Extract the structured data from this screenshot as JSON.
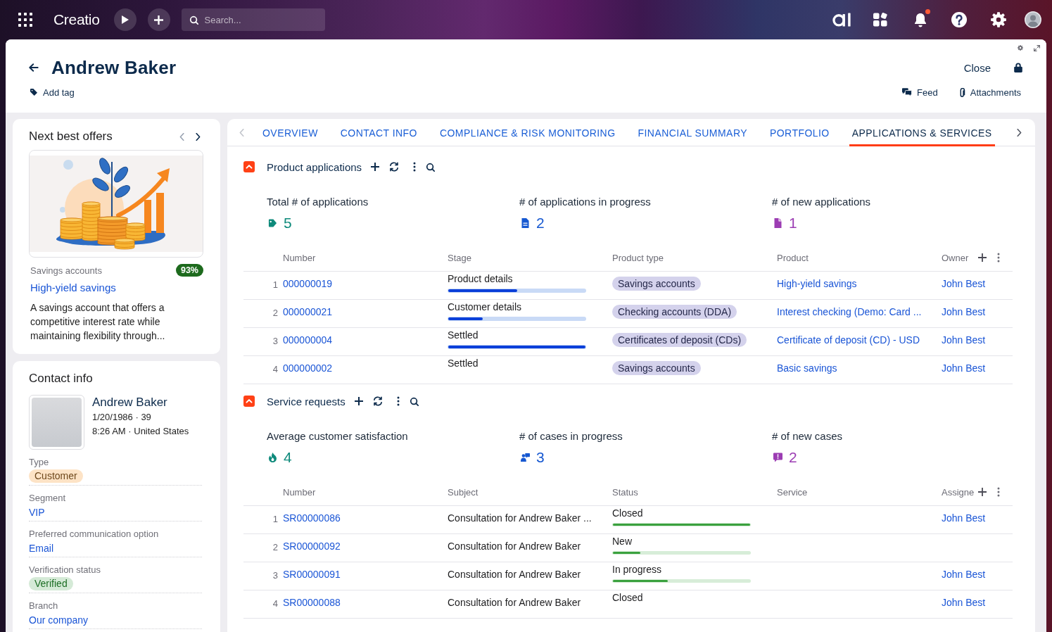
{
  "topbar": {
    "logo": "Creatio",
    "search": {
      "placeholder": "Search..."
    },
    "notifications": {
      "unread": true
    }
  },
  "record": {
    "title": "Andrew Baker",
    "add_tag": "Add tag",
    "close": "Close",
    "actions": [
      {
        "label": "Feed",
        "kind": "feed"
      },
      {
        "label": "Attachments",
        "kind": "attachments"
      }
    ]
  },
  "next_best_offers": {
    "title": "Next best offers",
    "previous_disabled": true,
    "next_disabled": false,
    "offer": {
      "category": "Savings accounts",
      "score": "93%",
      "name": "High-yield savings",
      "description": "A savings account that offers a competitive interest rate while maintaining flexibility through..."
    }
  },
  "contact_info": {
    "title": "Contact info",
    "name": "Andrew Baker",
    "birth_age": "1/20/1986 · 39",
    "local_time": "8:26 AM · United States",
    "fields": [
      {
        "label": "Type",
        "value": "Customer",
        "kind": "tag",
        "color": "#fde3c6"
      },
      {
        "label": "Segment",
        "value": "VIP",
        "kind": "link"
      },
      {
        "label": "Preferred communication option",
        "value": "Email",
        "kind": "link"
      },
      {
        "label": "Verification status",
        "value": "Verified",
        "kind": "tag",
        "color": "#d5ead7"
      },
      {
        "label": "Branch",
        "value": "Our company",
        "kind": "link"
      }
    ]
  },
  "tabs": {
    "back_disabled": true,
    "forward_disabled": false,
    "items": [
      {
        "label": "OVERVIEW",
        "selected": false
      },
      {
        "label": "CONTACT INFO",
        "selected": false
      },
      {
        "label": "COMPLIANCE & RISK MONITORING",
        "selected": false
      },
      {
        "label": "FINANCIAL SUMMARY",
        "selected": false
      },
      {
        "label": "PORTFOLIO",
        "selected": false
      },
      {
        "label": "APPLICATIONS & SERVICES",
        "selected": true
      }
    ]
  },
  "product_applications": {
    "title": "Product applications",
    "metrics": [
      {
        "label": "Total # of applications",
        "value": "5",
        "kind": "tag",
        "color": "#0e8a7b"
      },
      {
        "label": "# of applications in progress",
        "value": "2",
        "kind": "document",
        "color": "#1658d1"
      },
      {
        "label": "# of new applications",
        "value": "1",
        "kind": "file",
        "color": "#9c3db3"
      }
    ],
    "columns": [
      {
        "label": "Number",
        "kind": "link"
      },
      {
        "label": "Stage",
        "kind": "stage"
      },
      {
        "label": "Product type",
        "kind": "chip"
      },
      {
        "label": "Product",
        "kind": "link"
      },
      {
        "label": "Owner",
        "kind": "link"
      }
    ],
    "rows": [
      {
        "index": "1",
        "cells": [
          {
            "text": "000000019"
          },
          {
            "text": "Product details",
            "level": 0.5
          },
          {
            "text": "Savings accounts"
          },
          {
            "text": "High-yield savings"
          },
          {
            "text": "John Best"
          }
        ]
      },
      {
        "index": "2",
        "cells": [
          {
            "text": "000000021"
          },
          {
            "text": "Customer details",
            "level": 0.25
          },
          {
            "text": "Checking accounts (DDA)"
          },
          {
            "text": "Interest checking (Demo: Card ..."
          },
          {
            "text": "John Best"
          }
        ]
      },
      {
        "index": "3",
        "cells": [
          {
            "text": "000000004"
          },
          {
            "text": "Settled",
            "level": 1
          },
          {
            "text": "Certificates of deposit (CDs)"
          },
          {
            "text": "Certificate of deposit (CD) - USD"
          },
          {
            "text": "John Best"
          }
        ]
      },
      {
        "index": "4",
        "cells": [
          {
            "text": "000000002"
          },
          {
            "text": "Settled"
          },
          {
            "text": "Savings accounts"
          },
          {
            "text": "Basic savings"
          },
          {
            "text": "John Best"
          }
        ]
      }
    ]
  },
  "service_requests": {
    "title": "Service requests",
    "metrics": [
      {
        "label": "Average customer satisfaction",
        "value": "4",
        "kind": "flame",
        "color": "#0e8a7b"
      },
      {
        "label": "# of cases in progress",
        "value": "3",
        "kind": "person-chat",
        "color": "#1658d1"
      },
      {
        "label": "# of new cases",
        "value": "2",
        "kind": "alert-message",
        "color": "#9c3db3"
      }
    ],
    "columns": [
      {
        "label": "Number",
        "kind": "link"
      },
      {
        "label": "Subject",
        "kind": "text"
      },
      {
        "label": "Status",
        "kind": "status"
      },
      {
        "label": "Service"
      },
      {
        "label": "Assigne",
        "kind": "link"
      }
    ],
    "rows": [
      {
        "index": "1",
        "cells": [
          {
            "text": "SR00000086"
          },
          {
            "text": "Consultation for Andrew Baker ..."
          },
          {
            "text": "Closed",
            "level": 1
          },
          null,
          {
            "text": "John Best"
          }
        ]
      },
      {
        "index": "2",
        "cells": [
          {
            "text": "SR00000092"
          },
          {
            "text": "Consultation for Andrew Baker"
          },
          {
            "text": "New",
            "level": 0.2
          },
          null,
          null
        ]
      },
      {
        "index": "3",
        "cells": [
          {
            "text": "SR00000091"
          },
          {
            "text": "Consultation for Andrew Baker"
          },
          {
            "text": "In progress",
            "level": 0.4
          },
          null,
          {
            "text": "John Best"
          }
        ]
      },
      {
        "index": "4",
        "cells": [
          {
            "text": "SR00000088"
          },
          {
            "text": "Consultation for Andrew Baker"
          },
          {
            "text": "Closed"
          },
          null,
          {
            "text": "John Best"
          }
        ]
      }
    ]
  }
}
